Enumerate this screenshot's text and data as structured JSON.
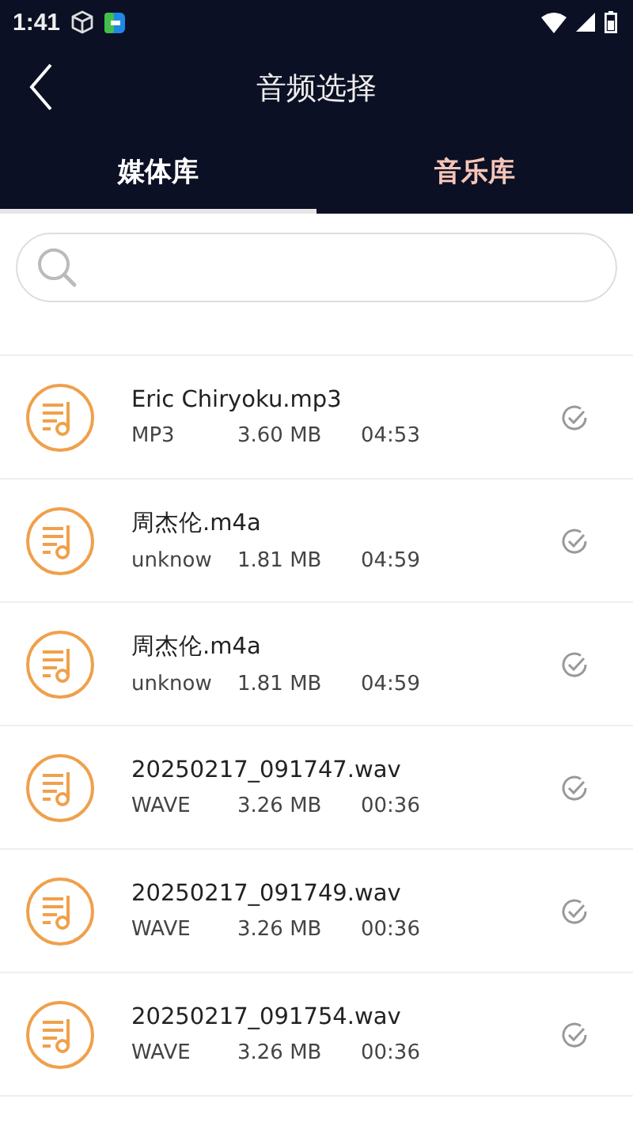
{
  "status_bar": {
    "time": "1:41"
  },
  "header": {
    "title": "音频选择"
  },
  "tabs": [
    {
      "label": "媒体库",
      "selected": true
    },
    {
      "label": "音乐库",
      "selected": false
    }
  ],
  "files": [
    {
      "name": "Eric Chiryoku.mp3",
      "format": "MP3",
      "size": "3.60 MB",
      "duration": "04:53",
      "selected": false
    },
    {
      "name": "周杰伦.m4a",
      "format": "unknow",
      "size": "1.81 MB",
      "duration": "04:59",
      "selected": false
    },
    {
      "name": "周杰伦.m4a",
      "format": "unknow",
      "size": "1.81 MB",
      "duration": "04:59",
      "selected": false
    },
    {
      "name": "20250217_091747.wav",
      "format": "WAVE",
      "size": "3.26 MB",
      "duration": "00:36",
      "selected": false
    },
    {
      "name": "20250217_091749.wav",
      "format": "WAVE",
      "size": "3.26 MB",
      "duration": "00:36",
      "selected": false
    },
    {
      "name": "20250217_091754.wav",
      "format": "WAVE",
      "size": "3.26 MB",
      "duration": "00:36",
      "selected": false
    }
  ]
}
